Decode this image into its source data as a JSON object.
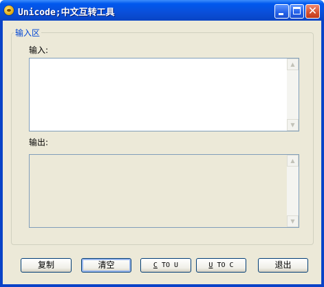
{
  "window": {
    "title": "Unicode;中文互转工具",
    "icon": "smiley-app-icon",
    "controls": {
      "minimize": "minimize",
      "maximize": "maximize",
      "close": "✕"
    }
  },
  "group": {
    "title": "输入区"
  },
  "input": {
    "label": "输入:",
    "value": ""
  },
  "output": {
    "label": "输出:",
    "value": ""
  },
  "scroll": {
    "up": "▲",
    "down": "▼"
  },
  "buttons": {
    "copy": "复制",
    "clear": "清空",
    "c_to_u": {
      "hotkey": "C",
      "rest": " TO U"
    },
    "u_to_c": {
      "hotkey": "U",
      "rest": " TO C"
    },
    "exit": "退出"
  },
  "colors": {
    "titlebar": "#0058ee",
    "client": "#ece9d8",
    "group_legend": "#0046d5",
    "field_border": "#7f9db9"
  }
}
